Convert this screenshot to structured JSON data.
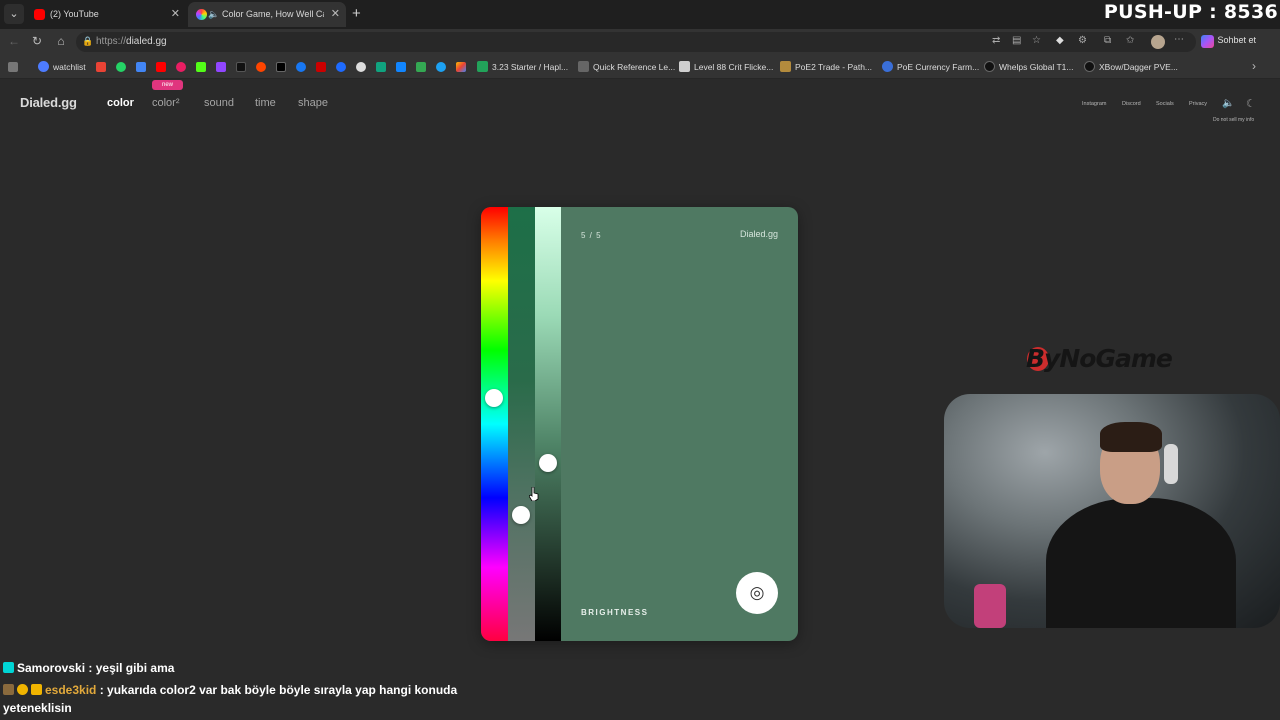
{
  "browser": {
    "tabs": [
      {
        "title": "(2) YouTube",
        "favicon_color": "#ff0000"
      },
      {
        "title": "Color Game, How Well Can You",
        "favicon_color": "#7d5cff"
      }
    ],
    "url_scheme": "https://",
    "url_host": "dialed.gg",
    "chat_label": "Sohbet et"
  },
  "stream": {
    "pushup_counter": "PUSH-UP : 8536",
    "sponsor": "ByNoGame"
  },
  "bookmarks": [
    {
      "label": "watchlist",
      "color": "#4d7cff"
    },
    {
      "label": "3.23 Starter / Hapl...",
      "color": "#22a35a"
    },
    {
      "label": "Quick Reference Le...",
      "color": "#666666"
    },
    {
      "label": "Level 88 Crit Flicke...",
      "color": "#cfcfcf"
    },
    {
      "label": "PoE2 Trade - Path...",
      "color": "#b38b3d"
    },
    {
      "label": "PoE Currency Farm...",
      "color": "#3a6fd8"
    },
    {
      "label": "Whelps Global T1...",
      "color": "#111111"
    },
    {
      "label": "XBow/Dagger PVE...",
      "color": "#111111"
    }
  ],
  "site": {
    "logo": "Dialed.gg",
    "nav": [
      "color",
      "color²",
      "sound",
      "time",
      "shape"
    ],
    "new_badge": "new",
    "links": [
      "Instagram",
      "Discord",
      "Socials",
      "Privacy"
    ],
    "do_not_sell": "Do not sell my info"
  },
  "game": {
    "round": "5 / 5",
    "brand": "Dialed.gg",
    "mode_label": "BRIGHTNESS",
    "current_color": "#4f7962",
    "submit_icon": "target-icon",
    "sliders": {
      "hue": 0.44,
      "saturation": 0.71,
      "brightness": 0.59
    }
  },
  "chat": [
    {
      "user": "Samorovski",
      "message": "yeşil gibi ama"
    },
    {
      "user": "esde3kid",
      "message": "yukarıda color2 var bak böyle böyle sırayla yap hangi konuda",
      "continuation": "yeteneklisin"
    }
  ]
}
